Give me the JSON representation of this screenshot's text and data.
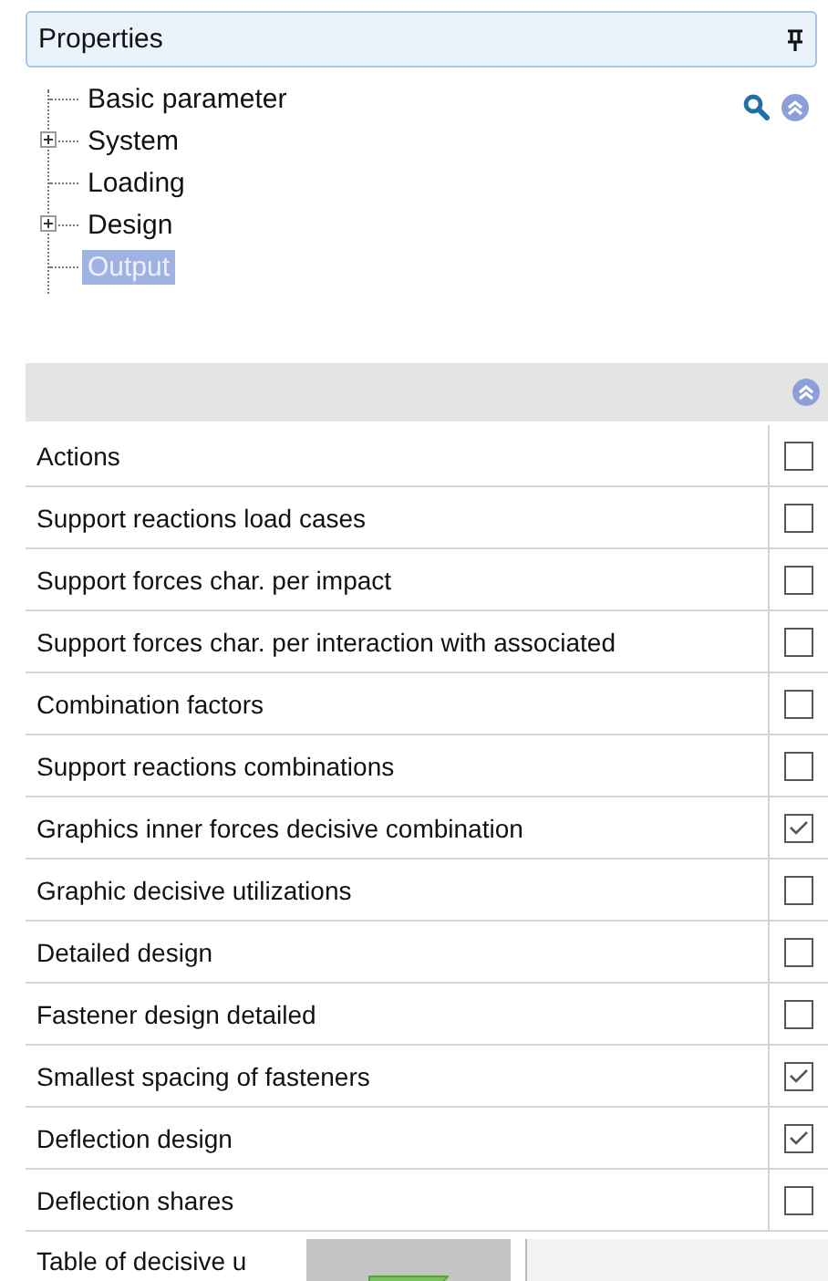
{
  "panel": {
    "title": "Properties"
  },
  "tree": [
    {
      "label": "Basic parameter",
      "expandable": false,
      "selected": false
    },
    {
      "label": "System",
      "expandable": true,
      "selected": false
    },
    {
      "label": "Loading",
      "expandable": false,
      "selected": false
    },
    {
      "label": "Design",
      "expandable": true,
      "selected": false
    },
    {
      "label": "Output",
      "expandable": false,
      "selected": true
    }
  ],
  "options": [
    {
      "label": "Actions",
      "checked": false
    },
    {
      "label": "Support reactions load cases",
      "checked": false
    },
    {
      "label": "Support forces char. per impact",
      "checked": false
    },
    {
      "label": "Support forces char. per interaction with associated",
      "checked": false
    },
    {
      "label": "Combination factors",
      "checked": false
    },
    {
      "label": "Support reactions combinations",
      "checked": false
    },
    {
      "label": "Graphics inner forces decisive combination",
      "checked": true
    },
    {
      "label": "Graphic decisive utilizations",
      "checked": false
    },
    {
      "label": "Detailed design",
      "checked": false
    },
    {
      "label": "Fastener design detailed",
      "checked": false
    },
    {
      "label": "Smallest spacing of fasteners",
      "checked": true
    },
    {
      "label": "Deflection design",
      "checked": true
    },
    {
      "label": "Deflection shares",
      "checked": false
    }
  ],
  "partial_row": {
    "label": "Table of decisive u"
  }
}
